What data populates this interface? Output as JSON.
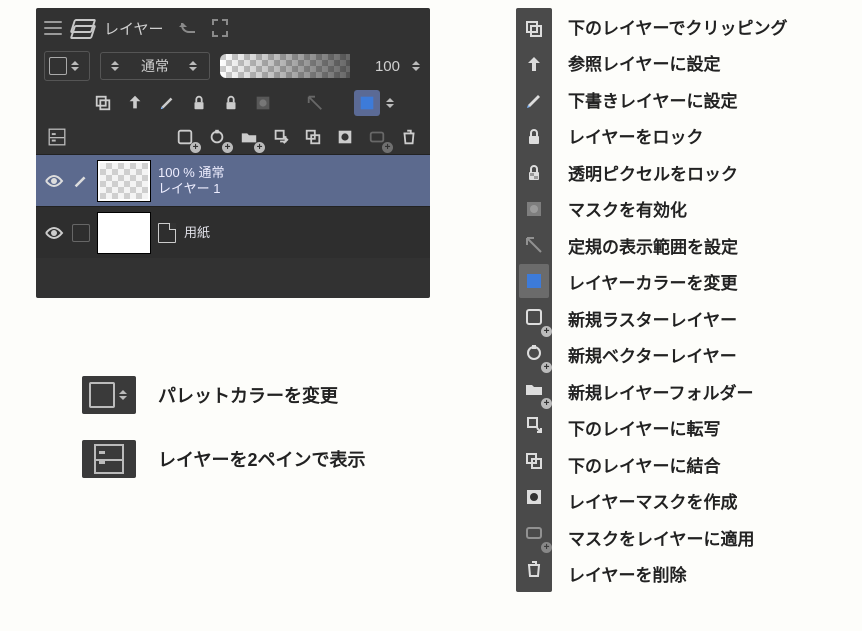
{
  "panel": {
    "tab_label": "レイヤー",
    "blend_mode_label": "通常",
    "opacity_value": "100",
    "layers": [
      {
        "opacity_line": "100 % 通常",
        "name": "レイヤー 1"
      },
      {
        "opacity_line": "",
        "name": "用紙"
      }
    ]
  },
  "legend": {
    "palette_change": "パレットカラーを変更",
    "two_pane": "レイヤーを2ペインで表示"
  },
  "strip": {
    "items": [
      {
        "icon": "clip-icon",
        "label": "下のレイヤーでクリッピング"
      },
      {
        "icon": "reference-icon",
        "label": "参照レイヤーに設定"
      },
      {
        "icon": "draft-icon",
        "label": "下書きレイヤーに設定"
      },
      {
        "icon": "lock-icon",
        "label": "レイヤーをロック"
      },
      {
        "icon": "lock-alpha-icon",
        "label": "透明ピクセルをロック"
      },
      {
        "icon": "mask-enable-icon",
        "label": "マスクを有効化"
      },
      {
        "icon": "ruler-range-icon",
        "label": "定規の表示範囲を設定"
      },
      {
        "icon": "layer-color-icon",
        "label": "レイヤーカラーを変更"
      },
      {
        "icon": "new-raster-icon",
        "label": "新規ラスターレイヤー"
      },
      {
        "icon": "new-vector-icon",
        "label": "新規ベクターレイヤー"
      },
      {
        "icon": "new-folder-icon",
        "label": "新規レイヤーフォルダー"
      },
      {
        "icon": "transfer-down-icon",
        "label": "下のレイヤーに転写"
      },
      {
        "icon": "merge-down-icon",
        "label": "下のレイヤーに結合"
      },
      {
        "icon": "create-mask-icon",
        "label": "レイヤーマスクを作成"
      },
      {
        "icon": "apply-mask-icon",
        "label": "マスクをレイヤーに適用"
      },
      {
        "icon": "delete-layer-icon",
        "label": "レイヤーを削除"
      }
    ]
  }
}
